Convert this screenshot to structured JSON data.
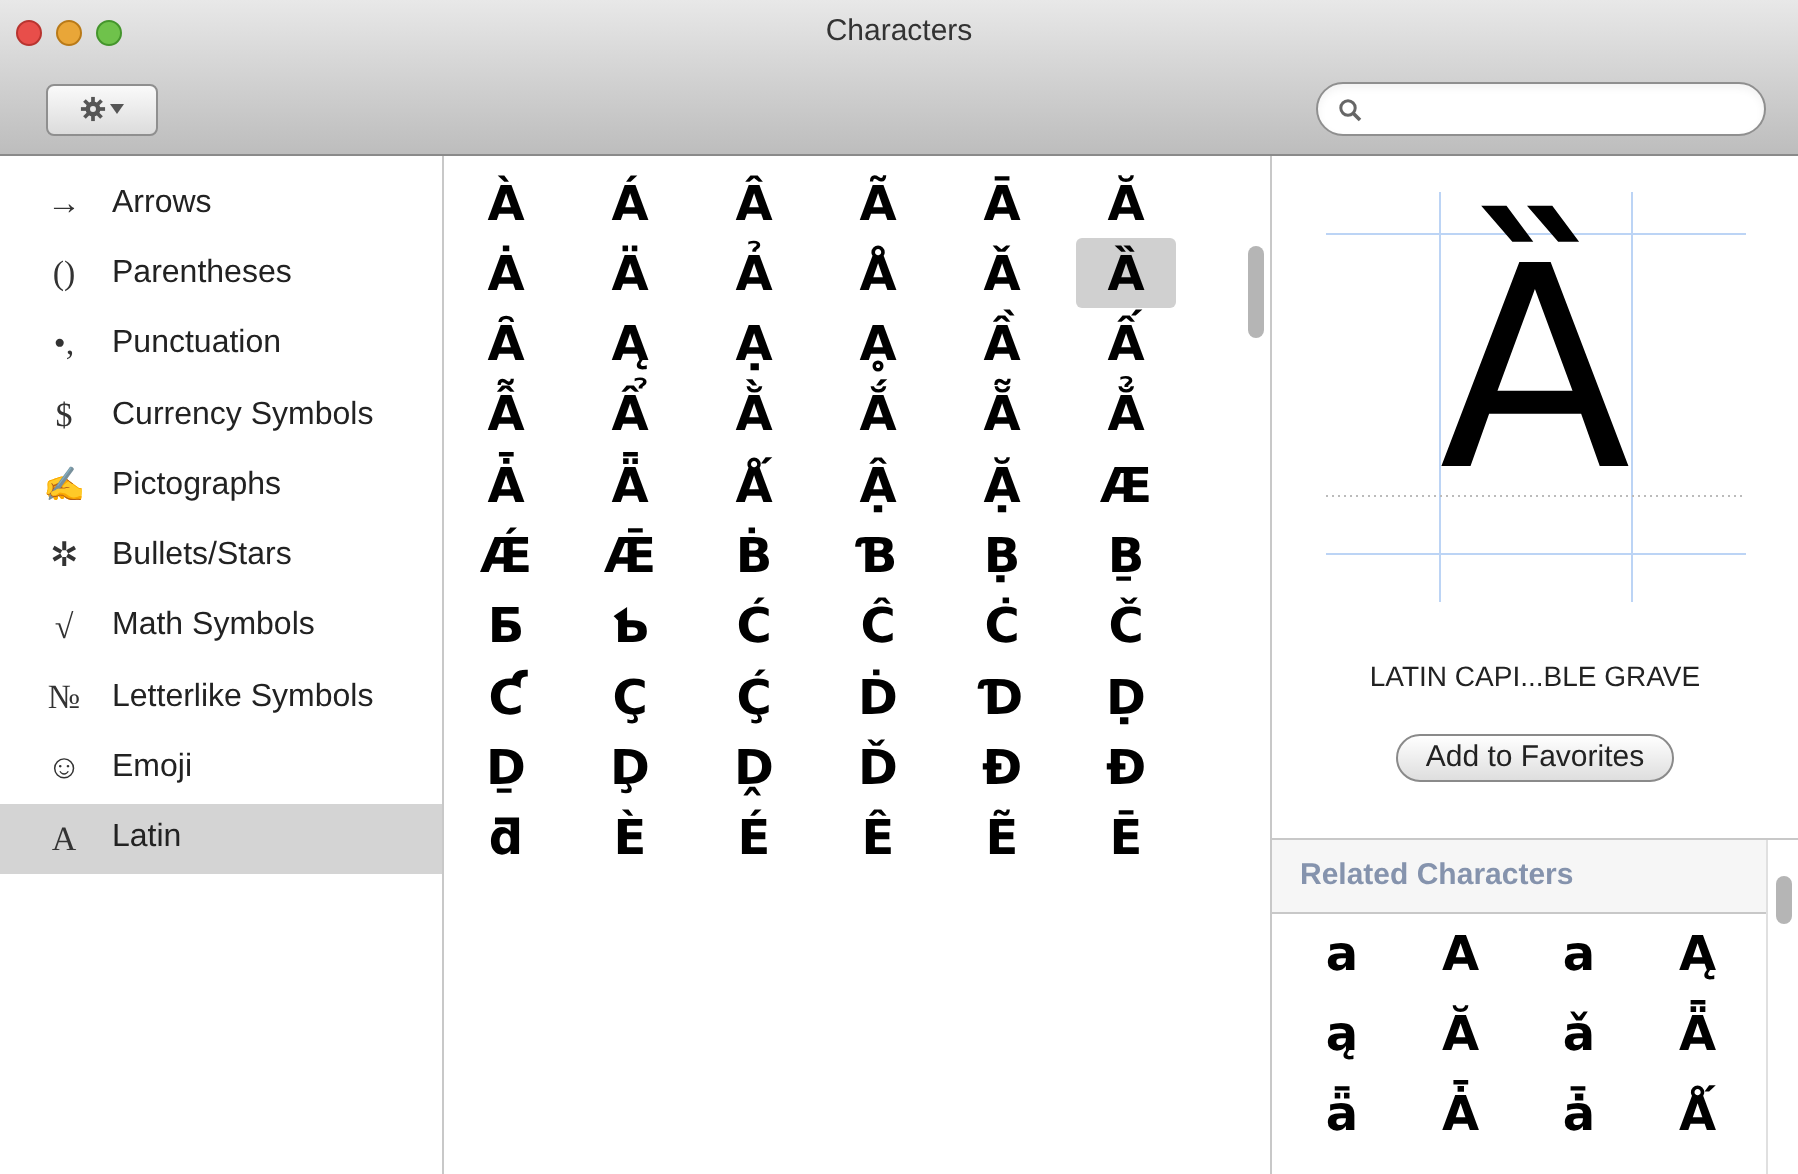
{
  "window": {
    "title": "Characters"
  },
  "sidebar": {
    "items": [
      {
        "glyph": "→",
        "label": "Arrows",
        "selected": false
      },
      {
        "glyph": "()",
        "label": "Parentheses",
        "selected": false
      },
      {
        "glyph": "•,",
        "label": "Punctuation",
        "selected": false
      },
      {
        "glyph": "$",
        "label": "Currency Symbols",
        "selected": false
      },
      {
        "glyph": "✍",
        "label": "Pictographs",
        "selected": false
      },
      {
        "glyph": "✲",
        "label": "Bullets/Stars",
        "selected": false
      },
      {
        "glyph": "√",
        "label": "Math Symbols",
        "selected": false
      },
      {
        "glyph": "№",
        "label": "Letterlike Symbols",
        "selected": false
      },
      {
        "glyph": "☺",
        "label": "Emoji",
        "selected": false
      },
      {
        "glyph": "A",
        "label": "Latin",
        "selected": true
      }
    ]
  },
  "grid": {
    "rows": [
      [
        {
          "char": "À",
          "selected": false
        },
        {
          "char": "Á",
          "selected": false
        },
        {
          "char": "Â",
          "selected": false
        },
        {
          "char": "Ã",
          "selected": false
        },
        {
          "char": "Ā",
          "selected": false
        },
        {
          "char": "Ă",
          "selected": false
        }
      ],
      [
        {
          "char": "Ȧ",
          "selected": false
        },
        {
          "char": "Ä",
          "selected": false
        },
        {
          "char": "Ả",
          "selected": false
        },
        {
          "char": "Å",
          "selected": false
        },
        {
          "char": "Ǎ",
          "selected": false
        },
        {
          "char": "Ȁ",
          "selected": true
        }
      ],
      [
        {
          "char": "Ȃ",
          "selected": false
        },
        {
          "char": "Ą",
          "selected": false
        },
        {
          "char": "Ạ",
          "selected": false
        },
        {
          "char": "Ḁ",
          "selected": false
        },
        {
          "char": "Ầ",
          "selected": false
        },
        {
          "char": "Ấ",
          "selected": false
        }
      ],
      [
        {
          "char": "Ẫ",
          "selected": false
        },
        {
          "char": "Ẩ",
          "selected": false
        },
        {
          "char": "Ằ",
          "selected": false
        },
        {
          "char": "Ắ",
          "selected": false
        },
        {
          "char": "Ẵ",
          "selected": false
        },
        {
          "char": "Ẳ",
          "selected": false
        }
      ],
      [
        {
          "char": "Ǡ",
          "selected": false
        },
        {
          "char": "Ǟ",
          "selected": false
        },
        {
          "char": "Ǻ",
          "selected": false
        },
        {
          "char": "Ậ",
          "selected": false
        },
        {
          "char": "Ặ",
          "selected": false
        },
        {
          "char": "Æ",
          "selected": false
        }
      ],
      [
        {
          "char": "Ǽ",
          "selected": false
        },
        {
          "char": "Ǣ",
          "selected": false
        },
        {
          "char": "Ḃ",
          "selected": false
        },
        {
          "char": "Ɓ",
          "selected": false
        },
        {
          "char": "Ḅ",
          "selected": false
        },
        {
          "char": "Ḇ",
          "selected": false
        }
      ],
      [
        {
          "char": "Ƃ",
          "selected": false
        },
        {
          "char": "Ƅ",
          "selected": false
        },
        {
          "char": "Ć",
          "selected": false
        },
        {
          "char": "Ĉ",
          "selected": false
        },
        {
          "char": "Ċ",
          "selected": false
        },
        {
          "char": "Č",
          "selected": false
        }
      ],
      [
        {
          "char": "Ƈ",
          "selected": false
        },
        {
          "char": "Ç",
          "selected": false
        },
        {
          "char": "Ḉ",
          "selected": false
        },
        {
          "char": "Ḋ",
          "selected": false
        },
        {
          "char": "Ɗ",
          "selected": false
        },
        {
          "char": "Ḍ",
          "selected": false
        }
      ],
      [
        {
          "char": "Ḏ",
          "selected": false
        },
        {
          "char": "Ḑ",
          "selected": false
        },
        {
          "char": "Ḓ",
          "selected": false
        },
        {
          "char": "Ď",
          "selected": false
        },
        {
          "char": "Đ",
          "selected": false
        },
        {
          "char": "Ɖ",
          "selected": false
        }
      ],
      [
        {
          "char": "ƌ",
          "selected": false
        },
        {
          "char": "È",
          "selected": false
        },
        {
          "char": "É",
          "selected": false
        },
        {
          "char": "Ê",
          "selected": false
        },
        {
          "char": "Ẽ",
          "selected": false
        },
        {
          "char": "Ē",
          "selected": false
        }
      ]
    ]
  },
  "preview": {
    "char": "Ȁ",
    "name": "LATIN CAPI...BLE GRAVE",
    "button": "Add to Favorites"
  },
  "related": {
    "title": "Related Characters",
    "chars": [
      "a",
      "A",
      "a",
      "Ą",
      "ą",
      "Ă",
      "ǎ",
      "Ǟ",
      "ǟ",
      "Ǡ",
      "ǡ",
      "Ǻ"
    ]
  }
}
